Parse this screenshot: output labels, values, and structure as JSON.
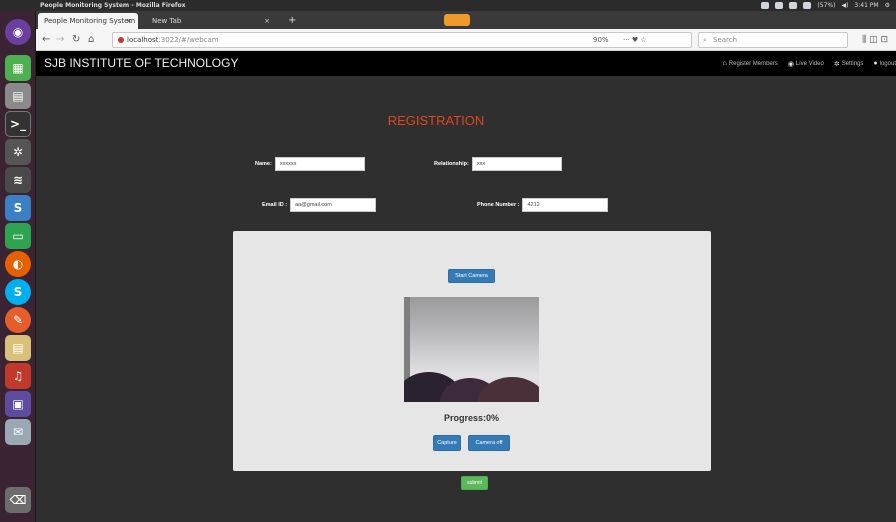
{
  "system": {
    "window_title": "People Monitoring System - Mozilla Firefox",
    "tray_status": "(57%)",
    "clock": "3:41 PM"
  },
  "browser": {
    "tabs": [
      {
        "label": "People Monitoring System",
        "close": "×"
      },
      {
        "label": "New Tab",
        "close": "×"
      }
    ],
    "new_tab": "+",
    "url_host": "localhost",
    "url_path": ":3022/#/webcam",
    "zoom": "90%",
    "page_actions": "···  ♥  ☆",
    "search_placeholder": "Search",
    "toolbar_icons": "⫼  ◫  ⊡"
  },
  "app": {
    "brand": "SJB INSTITUTE OF TECHNOLOGY",
    "nav": [
      {
        "icon": "⌂",
        "label": "Register Members"
      },
      {
        "icon": "◉",
        "label": "Live Video"
      },
      {
        "icon": "✲",
        "label": "Settings"
      },
      {
        "icon": "●",
        "label": "logout"
      }
    ]
  },
  "form": {
    "heading": "REGISTRATION",
    "name_label": "Name:",
    "name_value": "xxxxxx",
    "relationship_label": "Relationship:",
    "relationship_value": "xxx",
    "email_label": "Email ID :",
    "email_value": "aa@gmail.com",
    "phone_label": "Phone Number :",
    "phone_value": "4212"
  },
  "camera": {
    "start_label": "Start Camera",
    "progress_text": "Progress:0%",
    "capture_label": "Capture",
    "camera_off_label": "Camera off"
  },
  "submit_label": "submit",
  "colors": {
    "heading": "#e0461c",
    "primary_button": "#337ab7",
    "submit_button": "#5cb85c",
    "navbar": "#000000"
  }
}
